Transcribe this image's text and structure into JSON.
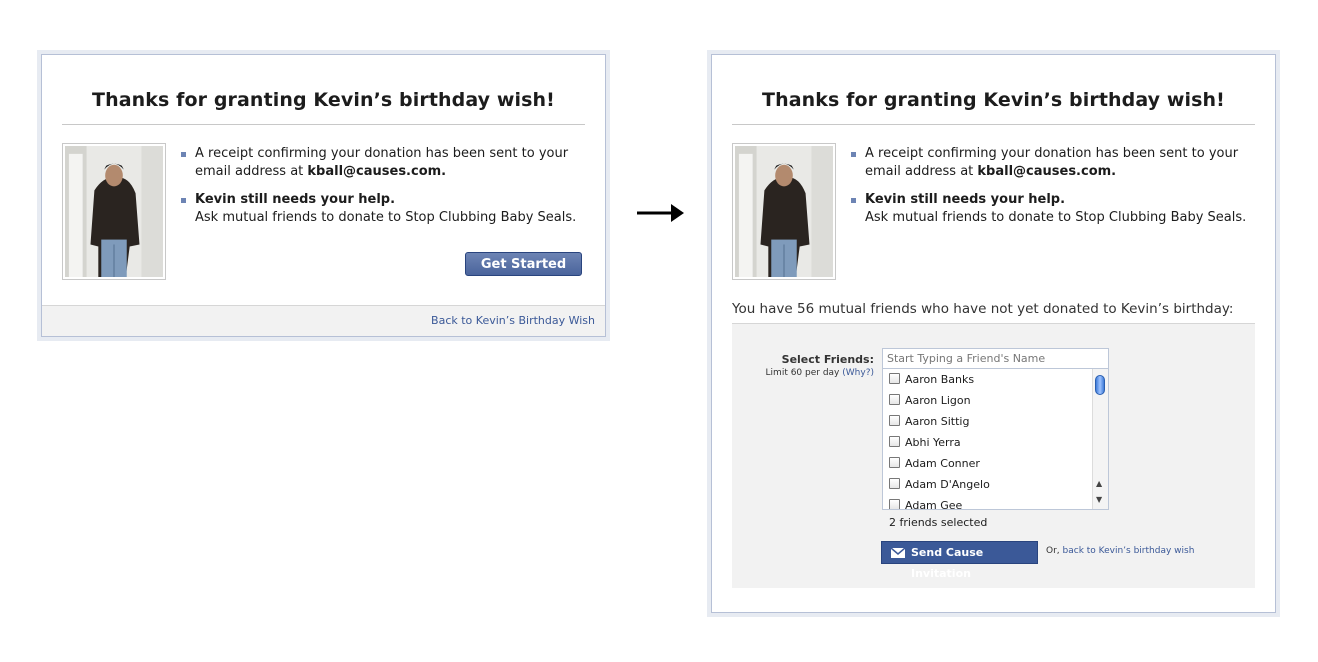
{
  "left_dialog": {
    "title": "Thanks for granting Kevin’s birthday wish!",
    "bullets": [
      {
        "line1": "A receipt confirming your donation has been sent to your",
        "line2_prefix": "email address at ",
        "line2_bold": "kball@causes.com."
      },
      {
        "line1_bold": "Kevin still needs your help.",
        "line2": "Ask mutual friends to donate to Stop Clubbing Baby Seals."
      }
    ],
    "get_started_label": "Get Started",
    "back_link": "Back to Kevin’s Birthday Wish"
  },
  "right_dialog": {
    "title": "Thanks for granting Kevin’s birthday wish!",
    "bullets": [
      {
        "line1": "A receipt confirming your donation has been sent to your",
        "line2_prefix": "email address at ",
        "line2_bold": "kball@causes.com."
      },
      {
        "line1_bold": "Kevin still needs your help.",
        "line2": "Ask mutual friends to donate to Stop Clubbing Baby Seals."
      }
    ],
    "mutual_text": "You have 56 mutual friends who have not yet donated to Kevin’s birthday:",
    "select_label": "Select Friends:",
    "limit_text": "Limit 60 per day",
    "why_link": "(Why?)",
    "search_placeholder": "Start Typing a Friend's Name",
    "friends": [
      "Aaron Banks",
      "Aaron Ligon",
      "Aaron Sittig",
      "Abhi Yerra",
      "Adam Conner",
      "Adam D'Angelo",
      "Adam Gee"
    ],
    "selected_count": "2 friends selected",
    "send_label": "Send Cause Invitation",
    "or_text": "Or, ",
    "back_link": "back to Kevin’s birthday wish"
  }
}
